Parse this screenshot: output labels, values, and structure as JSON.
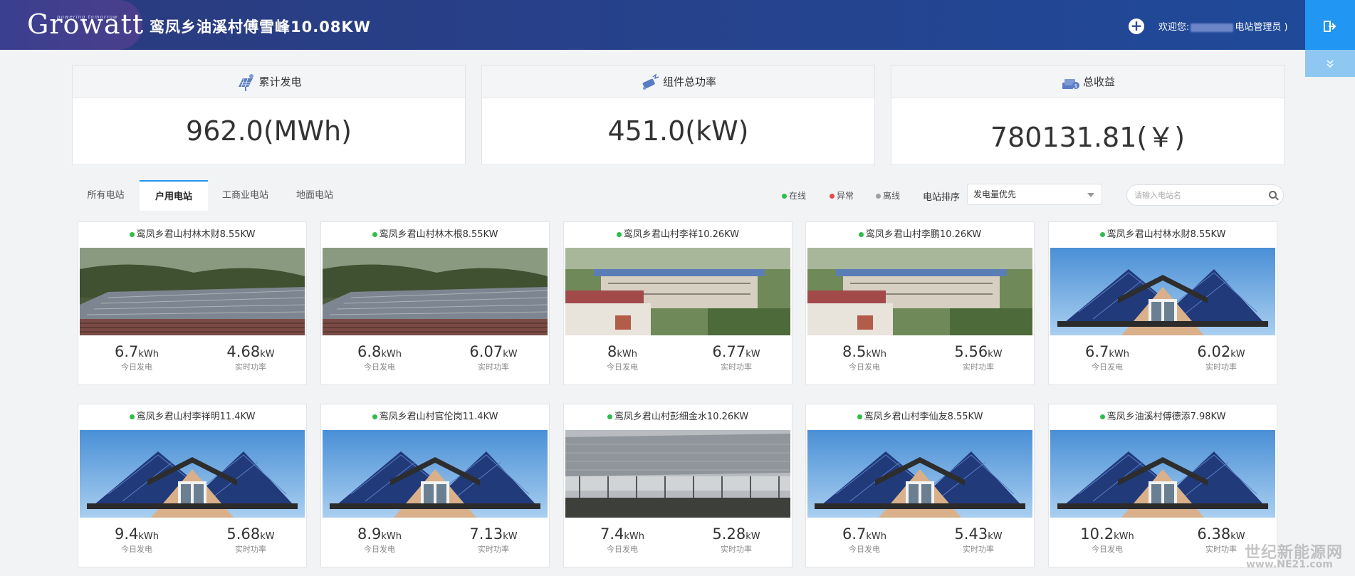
{
  "header": {
    "logo": "Growatt",
    "logo_tagline": "powering tomorrow",
    "station_title": "鸾凤乡油溪村傅雪峰10.08KW",
    "welcome_prefix": "欢迎您:",
    "welcome_role": "电站管理员 )",
    "add_icon": "plus-icon",
    "logout_icon": "logout-icon"
  },
  "summary": [
    {
      "label": "累计发电",
      "value": "962.0(MWh)",
      "icon": "solar-panel-icon"
    },
    {
      "label": "组件总功率",
      "value": "451.0(kW)",
      "icon": "power-icon"
    },
    {
      "label": "总收益",
      "value": "780131.81(￥)",
      "icon": "money-icon"
    }
  ],
  "tabs": [
    {
      "label": "所有电站",
      "active": false
    },
    {
      "label": "户用电站",
      "active": true
    },
    {
      "label": "工商业电站",
      "active": false
    },
    {
      "label": "地面电站",
      "active": false
    }
  ],
  "legend": [
    {
      "label": "在线",
      "color": "#2ebd4a"
    },
    {
      "label": "异常",
      "color": "#e14b4b"
    },
    {
      "label": "离线",
      "color": "#a0a0a0"
    }
  ],
  "sort": {
    "label": "电站排序",
    "selected": "发电量优先"
  },
  "search": {
    "placeholder": "请输入电站名"
  },
  "stat_labels": {
    "today": "今日发电",
    "power": "实时功率"
  },
  "plants": [
    {
      "name": "鸾凤乡君山村林木财8.55KW",
      "today": "6.7",
      "today_unit": "kWh",
      "power": "4.68",
      "power_unit": "kW",
      "photo": "hillside-roof"
    },
    {
      "name": "鸾凤乡君山村林木根8.55KW",
      "today": "6.8",
      "today_unit": "kWh",
      "power": "6.07",
      "power_unit": "kW",
      "photo": "hillside-roof"
    },
    {
      "name": "鸾凤乡君山村李祥10.26KW",
      "today": "8",
      "today_unit": "kWh",
      "power": "6.77",
      "power_unit": "kW",
      "photo": "village-building"
    },
    {
      "name": "鸾凤乡君山村李鹏10.26KW",
      "today": "8.5",
      "today_unit": "kWh",
      "power": "5.56",
      "power_unit": "kW",
      "photo": "village-building"
    },
    {
      "name": "鸾凤乡君山村林水财8.55KW",
      "today": "6.7",
      "today_unit": "kWh",
      "power": "6.02",
      "power_unit": "kW",
      "photo": "house"
    },
    {
      "name": "鸾凤乡君山村李祥明11.4KW",
      "today": "9.4",
      "today_unit": "kWh",
      "power": "5.68",
      "power_unit": "kW",
      "photo": "house"
    },
    {
      "name": "鸾凤乡君山村官伦岗11.4KW",
      "today": "8.9",
      "today_unit": "kWh",
      "power": "7.13",
      "power_unit": "kW",
      "photo": "house"
    },
    {
      "name": "鸾凤乡君山村彭细金水10.26KW",
      "today": "7.4",
      "today_unit": "kWh",
      "power": "5.28",
      "power_unit": "kW",
      "photo": "ground-array"
    },
    {
      "name": "鸾凤乡君山村李仙友8.55KW",
      "today": "6.7",
      "today_unit": "kWh",
      "power": "5.43",
      "power_unit": "kW",
      "photo": "house"
    },
    {
      "name": "鸾凤乡油溪村傅德添7.98KW",
      "today": "10.2",
      "today_unit": "kWh",
      "power": "6.38",
      "power_unit": "kW",
      "photo": "house"
    }
  ],
  "watermark": {
    "line1": "世纪新能源网",
    "line2": "www.NE21.com"
  }
}
